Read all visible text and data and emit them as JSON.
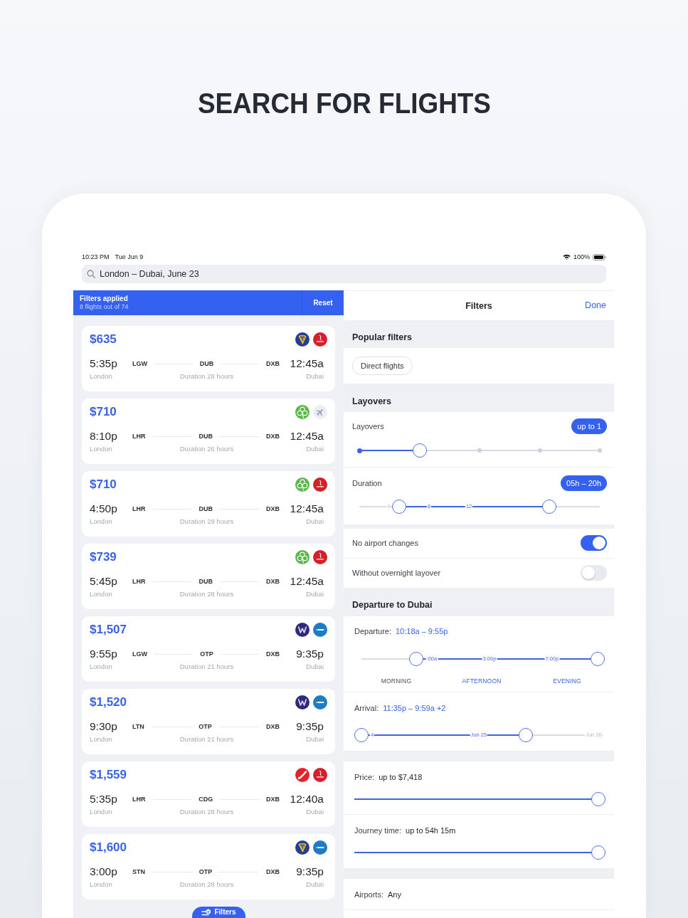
{
  "heading": "SEARCH FOR FLIGHTS",
  "status_bar": {
    "time": "10:23 PM",
    "date": "Tue Jun 9",
    "battery": "100%"
  },
  "search": {
    "value": "London – Dubai, June 23"
  },
  "results": {
    "banner": {
      "title": "Filters applied",
      "subtitle": "8 flights out of 74",
      "reset": "Reset"
    },
    "flights": [
      {
        "price": "$635",
        "logos": [
          {
            "kind": "harp"
          },
          {
            "kind": "emblem"
          }
        ],
        "depart_time": "5:35p",
        "origin": "LGW",
        "stopover": "DUB",
        "destination": "DXB",
        "arrive_time": "12:45a",
        "from_city": "London",
        "duration": "Duration 28 hours",
        "to_city": "Dubai"
      },
      {
        "price": "$710",
        "logos": [
          {
            "kind": "clover"
          },
          {
            "kind": "plane"
          }
        ],
        "depart_time": "8:10p",
        "origin": "LHR",
        "stopover": "DUB",
        "destination": "DXB",
        "arrive_time": "12:45a",
        "from_city": "London",
        "duration": "Duration 26 hours",
        "to_city": "Dubai"
      },
      {
        "price": "$710",
        "logos": [
          {
            "kind": "clover"
          },
          {
            "kind": "emblem"
          }
        ],
        "depart_time": "4:50p",
        "origin": "LHR",
        "stopover": "DUB",
        "destination": "DXB",
        "arrive_time": "12:45a",
        "from_city": "London",
        "duration": "Duration 29 hours",
        "to_city": "Dubai"
      },
      {
        "price": "$739",
        "logos": [
          {
            "kind": "clover"
          },
          {
            "kind": "emblem"
          }
        ],
        "depart_time": "5:45p",
        "origin": "LHR",
        "stopover": "DUB",
        "destination": "DXB",
        "arrive_time": "12:45a",
        "from_city": "London",
        "duration": "Duration 28 hours",
        "to_city": "Dubai"
      },
      {
        "price": "$1,507",
        "logos": [
          {
            "kind": "zigzag"
          },
          {
            "kind": "wordmark"
          }
        ],
        "depart_time": "9:55p",
        "origin": "LGW",
        "stopover": "OTP",
        "destination": "DXB",
        "arrive_time": "9:35p",
        "from_city": "London",
        "duration": "Duration 21 hours",
        "to_city": "Dubai"
      },
      {
        "price": "$1,520",
        "logos": [
          {
            "kind": "zigzag"
          },
          {
            "kind": "wordmark"
          }
        ],
        "depart_time": "9:30p",
        "origin": "LTN",
        "stopover": "OTP",
        "destination": "DXB",
        "arrive_time": "9:35p",
        "from_city": "London",
        "duration": "Duration 21 hours",
        "to_city": "Dubai"
      },
      {
        "price": "$1,559",
        "logos": [
          {
            "kind": "stripe"
          },
          {
            "kind": "emblem"
          }
        ],
        "depart_time": "5:35p",
        "origin": "LHR",
        "stopover": "CDG",
        "destination": "DXB",
        "arrive_time": "12:40a",
        "from_city": "London",
        "duration": "Duration 28 hours",
        "to_city": "Dubai"
      },
      {
        "price": "$1,600",
        "logos": [
          {
            "kind": "harp"
          },
          {
            "kind": "wordmark"
          }
        ],
        "depart_time": "3:00p",
        "origin": "STN",
        "stopover": "OTP",
        "destination": "DXB",
        "arrive_time": "9:35p",
        "from_city": "London",
        "duration": "Duration 28 hours",
        "to_city": "Dubai"
      }
    ],
    "filters_button": "Filters"
  },
  "filters": {
    "title": "Filters",
    "done": "Done",
    "popular": {
      "heading": "Popular filters",
      "chips": [
        {
          "label": "Direct flights",
          "selected": false
        }
      ]
    },
    "layovers": {
      "heading": "Layovers",
      "stops": {
        "label": "Layovers",
        "badge": "up to 1",
        "level": 0.25
      },
      "duration": {
        "label": "Duration",
        "badge": "05h – 20h",
        "ticks": [
          "4",
          "8",
          "12"
        ],
        "thumbs": [
          {
            "level": 0.166
          },
          {
            "level": 0.79
          }
        ]
      }
    },
    "toggles": [
      {
        "label": "No airport changes",
        "on": true
      },
      {
        "label": "Without overnight layover",
        "on": false
      }
    ],
    "departure_to": {
      "heading": "Departure to Dubai",
      "departure": {
        "label": "Departure:",
        "value": "10:18a – 9:55p",
        "ticks": [
          ":00a",
          "3:00p",
          "7:00p"
        ],
        "thumbs": [
          {
            "level": 0.232
          },
          {
            "level": 1
          }
        ],
        "periods": [
          {
            "label": "MORNING",
            "selected": false
          },
          {
            "label": "AFTERNOON",
            "selected": true
          },
          {
            "label": "EVENING",
            "selected": true
          }
        ]
      },
      "arrival": {
        "label": "Arrival:",
        "value": "11:35p – 9:59a +2",
        "ticks": [
          "4",
          "Jun 25",
          "Jun 26"
        ],
        "thumbs": [
          {
            "level": 0
          },
          {
            "level": 0.68
          }
        ]
      }
    },
    "price": {
      "label": "Price:",
      "value": "up to $7,418",
      "level": 1
    },
    "journey_time": {
      "label": "Journey time:",
      "value": "up to 54h 15m",
      "level": 1
    },
    "airports": {
      "label": "Airports:",
      "value": "Any"
    }
  }
}
